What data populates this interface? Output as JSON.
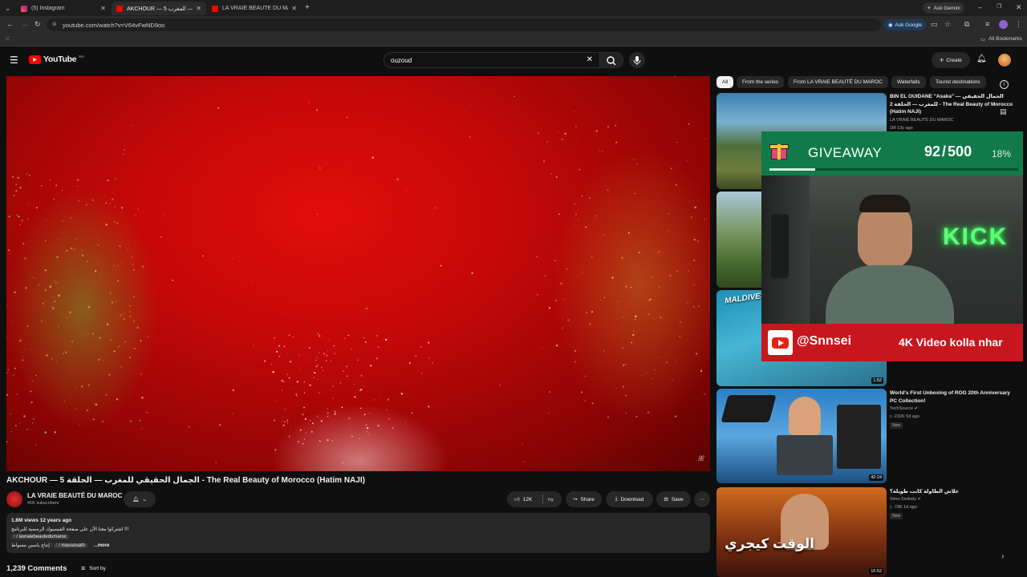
{
  "browser": {
    "tabs": [
      {
        "title": "(5) Instagram",
        "active": false
      },
      {
        "title": "AKCHOUR — 5 الحلقة — المغرب",
        "active": true
      },
      {
        "title": "LA VRAIE BEAUTÉ DU MAROC",
        "active": false
      }
    ],
    "url": "youtube.com/watch?v=V64vFwND9oo",
    "ask_gemini": "Ask Gemini",
    "ask_google": "Ask Google",
    "all_bookmarks": "All Bookmarks"
  },
  "header": {
    "logo_text": "YouTube",
    "country_code": "MA",
    "search_value": "ouzoud",
    "create_label": "Create"
  },
  "video": {
    "title": "AKCHOUR — 5 الجمال الحقيقي للمغرب — الحلقة - The Real Beauty of Morocco (Hatim NAJI)",
    "channel": "LA VRAIE BEAUTÉ DU MAROC",
    "subscribers": "41K subscribers",
    "likes": "12K",
    "share_label": "Share",
    "download_label": "Download",
    "save_label": "Save",
    "views_date": "1.6M views  12 years ago",
    "desc_line1": "اشتركوا معنا الآن على صفحة الفيسبوك الرسمية للبرنامج !!!",
    "desc_line2": "/ lavraiebeautedumaroc",
    "desc_line3": "إنتاج ياسين مسواط :",
    "desc_line3_handle": "/ massouath",
    "more": "...more",
    "comments_count": "1,239 Comments",
    "sort_by": "Sort by"
  },
  "chips": [
    "All",
    "From the series",
    "From LA VRAIE BEAUTÉ DU MAROC",
    "Waterfalls",
    "Tourist destinations"
  ],
  "recommendations": [
    {
      "title": "BIN EL OUIDANE \"Asaka\" — الجمال الحقيقي للمغرب — الحلقة 2 - The Real Beauty of Morocco (Hatim NAJI)",
      "channel": "LA VRAIE BEAUTÉ DU MAROC",
      "meta": "1M  13y ago"
    },
    {
      "title": "",
      "channel": "",
      "meta": ""
    },
    {
      "title": "",
      "channel": "",
      "meta": "",
      "duration": "1:52",
      "thumb_text": "MALDIVES"
    },
    {
      "title": "World's First Unboxing of ROG 20th Anniversary PC Collection!",
      "channel": "TechSource",
      "meta": "232K  5d ago",
      "badge": "New",
      "duration": "42:24"
    },
    {
      "title": "علاش الطاولة كانت طويلة؟",
      "channel": "Simo Sedraty",
      "meta": "79K  1d ago",
      "badge": "New",
      "duration": "16:52",
      "thumb_text": "الوقت كيجري"
    }
  ],
  "overlay": {
    "giveaway_label": "GIVEAWAY",
    "giveaway_current": "92",
    "giveaway_total": "500",
    "giveaway_percent": "18%",
    "giveaway_progress": 0.184,
    "handle": "@Snnsei",
    "tagline": "4K Video kolla nhar",
    "neon_text": "KICK"
  }
}
